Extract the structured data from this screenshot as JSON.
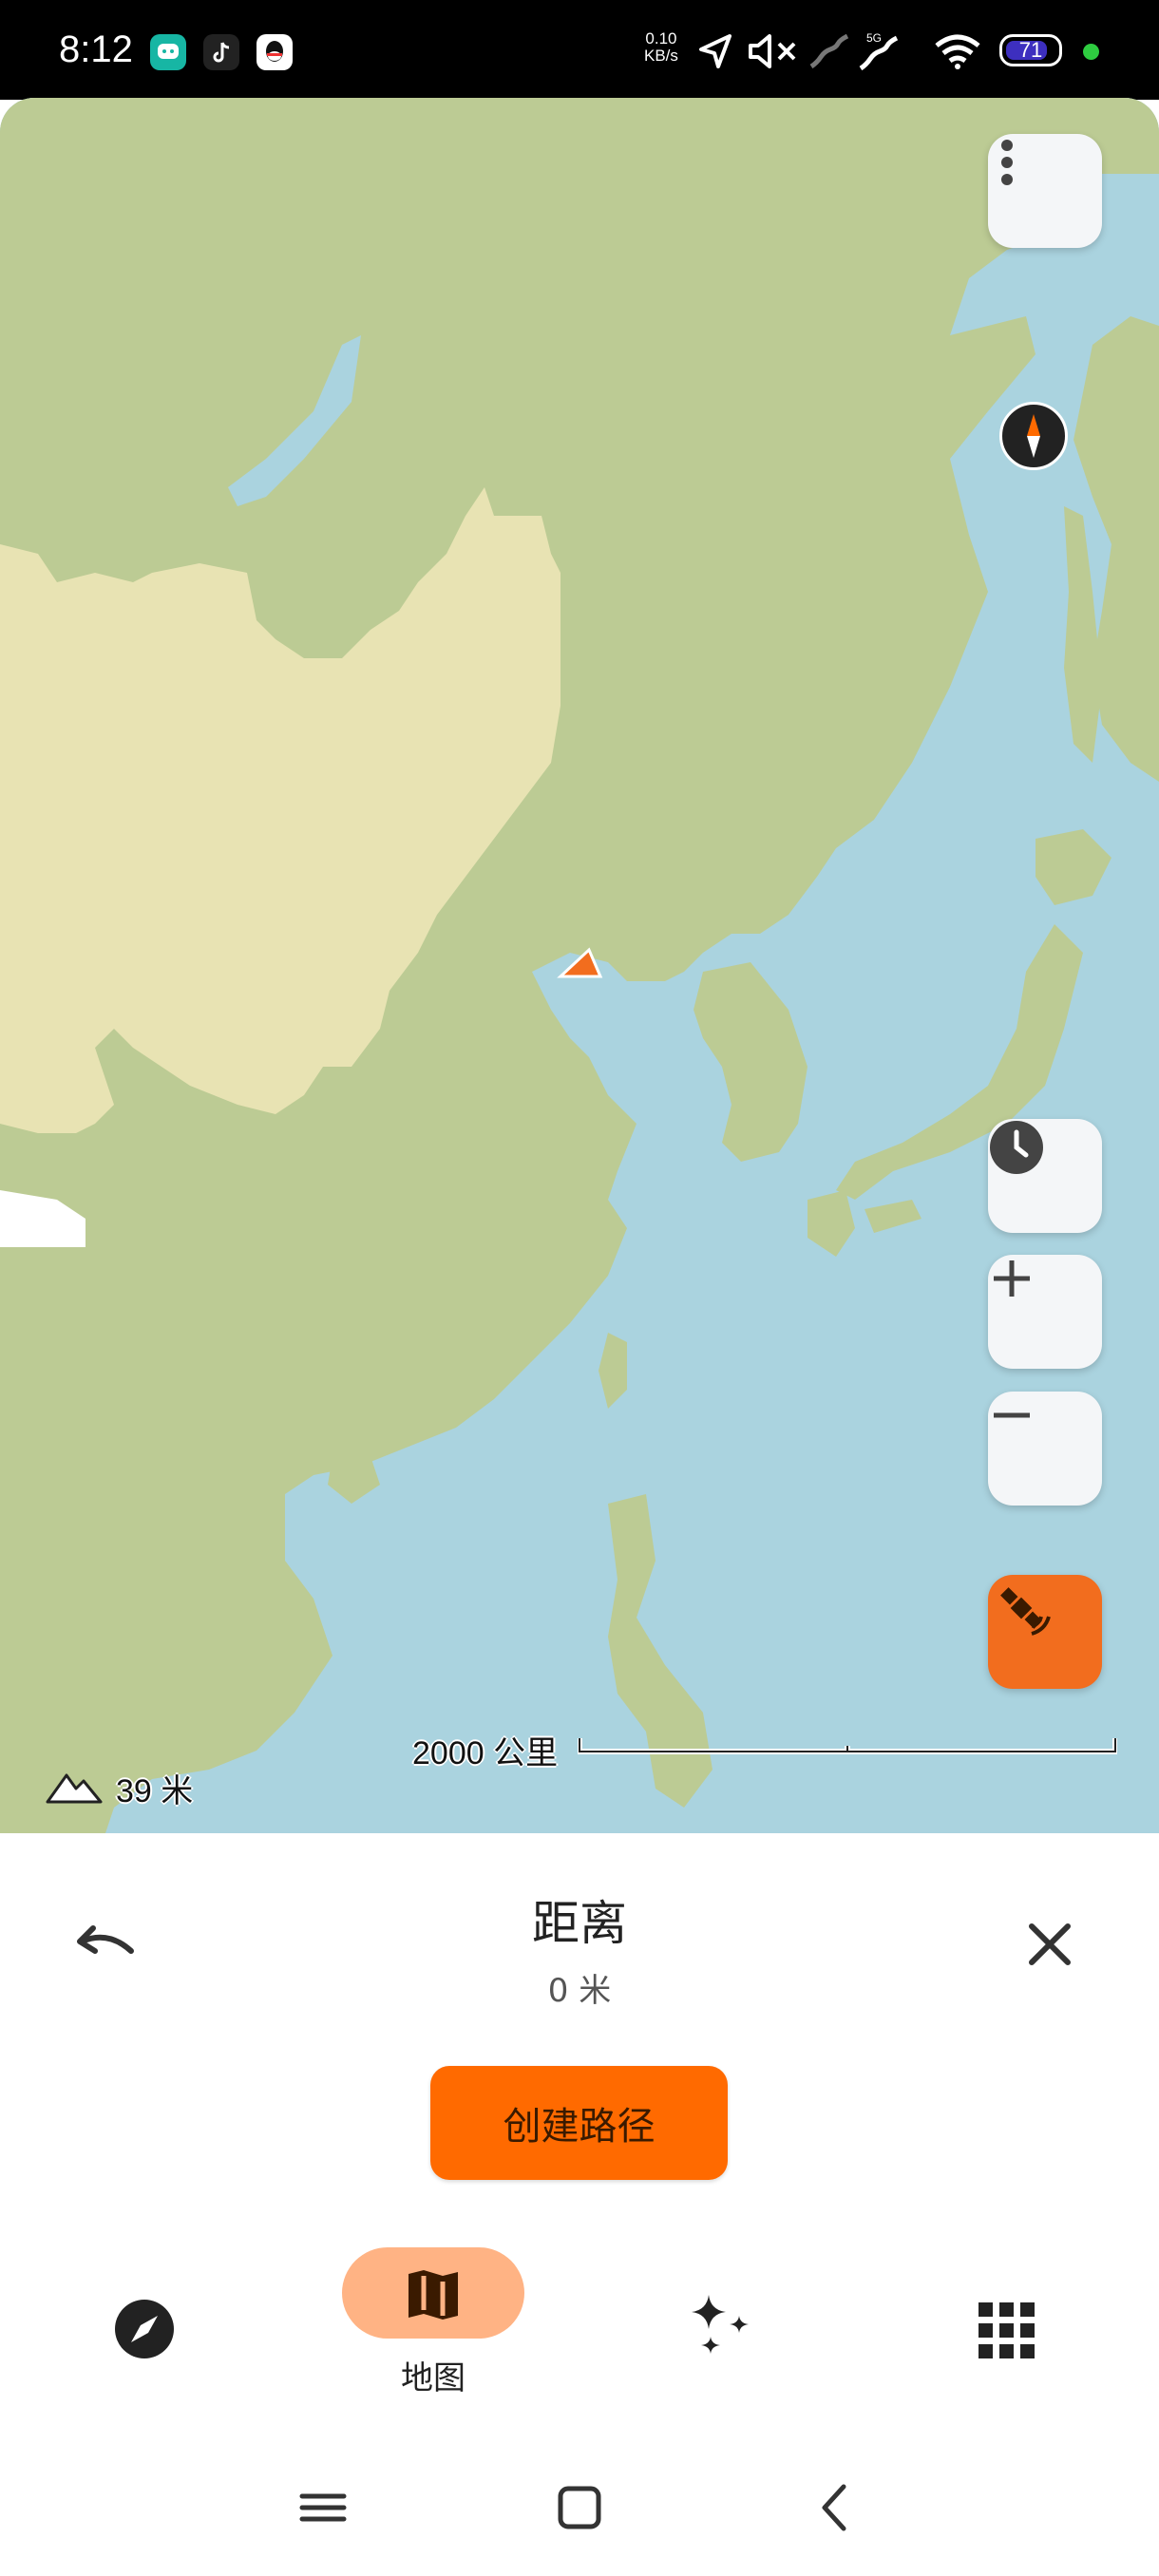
{
  "status_bar": {
    "time": "8:12",
    "net_speed_value": "0.10",
    "net_speed_unit": "KB/s",
    "network_type": "5G",
    "battery": "71",
    "app_icons": [
      "chat-app-icon",
      "tiktok-icon",
      "qq-icon"
    ],
    "status_icons": [
      "location-arrow-icon",
      "mute-icon",
      "signal-icon",
      "signal-5g-icon",
      "wifi-icon",
      "battery-icon"
    ]
  },
  "map": {
    "menu_icon": "more-vertical-icon",
    "compass_icon": "compass-icon",
    "history_icon": "clock-icon",
    "zoom_in_icon": "plus-icon",
    "zoom_out_icon": "minus-icon",
    "gps_icon": "satellite-icon",
    "elevation": "39 米",
    "scale_label": "2000 公里",
    "colors": {
      "water": "#aad3df",
      "land": "#bccb94",
      "highlight_land": "#e8e3b3",
      "accent": "#f26d1e"
    }
  },
  "sheet": {
    "title": "距离",
    "distance": "0 米",
    "undo_icon": "undo-icon",
    "close_icon": "close-icon",
    "create_route_label": "创建路径"
  },
  "bottom_nav": {
    "items": [
      {
        "icon": "navigation-compass-icon",
        "label": ""
      },
      {
        "icon": "map-icon",
        "label": "地图",
        "active": true
      },
      {
        "icon": "sparkles-icon",
        "label": ""
      },
      {
        "icon": "grid-icon",
        "label": ""
      }
    ]
  },
  "system_nav": [
    "menu-icon",
    "home-square-icon",
    "back-chevron-icon"
  ]
}
